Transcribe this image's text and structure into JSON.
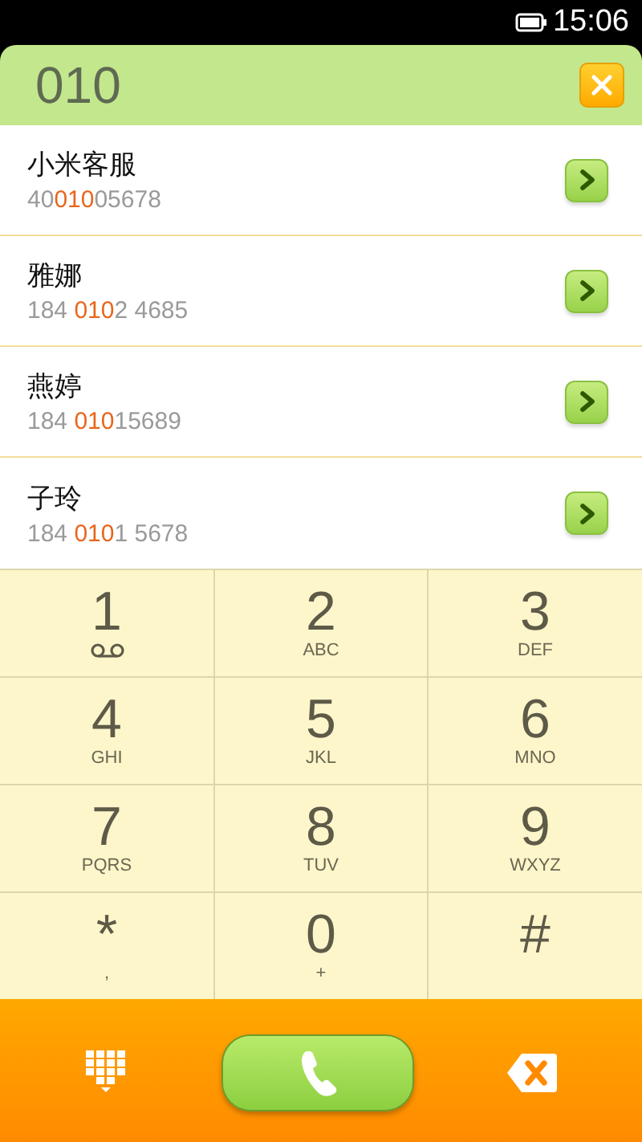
{
  "status_bar": {
    "time": "15:06"
  },
  "search": {
    "value": "010"
  },
  "contacts": [
    {
      "name": "小米客服",
      "number": [
        {
          "text": "40",
          "highlighted": false
        },
        {
          "text": "010",
          "highlighted": true
        },
        {
          "text": "05678",
          "highlighted": false
        }
      ]
    },
    {
      "name": "雅娜",
      "number": [
        {
          "text": "184 ",
          "highlighted": false
        },
        {
          "text": "010",
          "highlighted": true
        },
        {
          "text": "2 4685",
          "highlighted": false
        }
      ]
    },
    {
      "name": "燕婷",
      "number": [
        {
          "text": "184 ",
          "highlighted": false
        },
        {
          "text": "010",
          "highlighted": true
        },
        {
          "text": "15689",
          "highlighted": false
        }
      ]
    },
    {
      "name": "子玲",
      "number": [
        {
          "text": "184 ",
          "highlighted": false
        },
        {
          "text": "010",
          "highlighted": true
        },
        {
          "text": "1 5678",
          "highlighted": false
        }
      ]
    }
  ],
  "keypad": [
    {
      "key": "1",
      "kind": "voicemail"
    },
    {
      "key": "2",
      "kind": "letters",
      "sub": "ABC"
    },
    {
      "key": "3",
      "kind": "letters",
      "sub": "DEF"
    },
    {
      "key": "4",
      "kind": "letters",
      "sub": "GHI"
    },
    {
      "key": "5",
      "kind": "letters",
      "sub": "JKL"
    },
    {
      "key": "6",
      "kind": "letters",
      "sub": "MNO"
    },
    {
      "key": "7",
      "kind": "letters",
      "sub": "PQRS"
    },
    {
      "key": "8",
      "kind": "letters",
      "sub": "TUV"
    },
    {
      "key": "9",
      "kind": "letters",
      "sub": "WXYZ"
    },
    {
      "key": "*",
      "kind": "letters",
      "sub": ","
    },
    {
      "key": "0",
      "kind": "letters",
      "sub": "+"
    },
    {
      "key": "#",
      "kind": "none"
    }
  ]
}
